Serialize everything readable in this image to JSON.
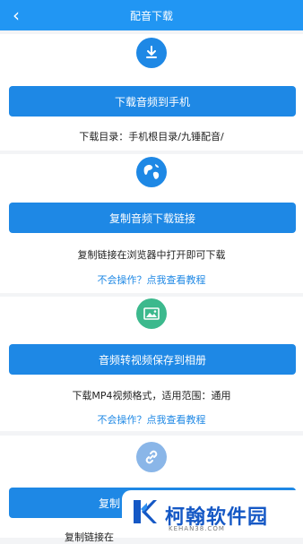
{
  "header": {
    "title": "配音下载",
    "back_icon": "chevron-left-icon"
  },
  "sections": [
    {
      "icon": "download-icon",
      "icon_color": "#1e88e5",
      "button_label": "下载音频到手机",
      "text": "下载目录：手机根目录/九锤配音/"
    },
    {
      "icon": "globe-icon",
      "icon_color": "#1e88e5",
      "button_label": "复制音频下载链接",
      "text": "复制链接在浏览器中打开即可下载",
      "link": "不会操作？点我查看教程"
    },
    {
      "icon": "image-icon",
      "icon_color": "#3cb98d",
      "button_label": "音频转视频保存到相册",
      "text": "下载MP4视频格式，适用范围：通用",
      "link": "不会操作？点我查看教程"
    },
    {
      "icon": "link-icon",
      "icon_color": "#8ab6e8",
      "button_label": "复制",
      "text": "复制链接在"
    }
  ],
  "watermark": {
    "name": "柯翰软件园",
    "url": "KEHAN38.COM",
    "logo_color": "#1558c5"
  },
  "colors": {
    "header_bg": "#2196f3",
    "button_bg": "#1e88e5",
    "link": "#1e88e5",
    "page_bg": "#f3f4f6"
  }
}
